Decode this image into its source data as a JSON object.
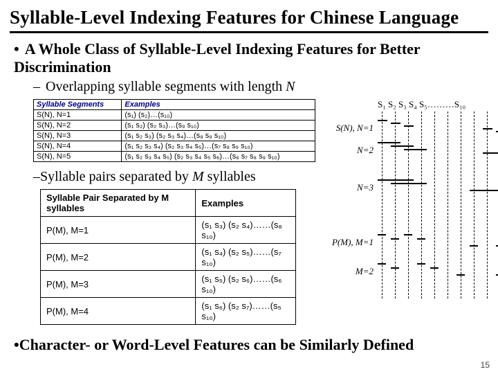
{
  "title": "Syllable-Level Indexing Features for Chinese Language",
  "bullet1": "A Whole Class of Syllable-Level Indexing Features for Better Discrimination",
  "sub1_prefix": "Overlapping syllable segments with length ",
  "sub1_ital": "N",
  "table1": {
    "headers": [
      "Syllable Segments",
      "Examples"
    ],
    "rows": [
      [
        "S(N), N=1",
        "(s₁) (s₂)…(s₁₀)"
      ],
      [
        "S(N), N=2",
        "(s₁ s₂) (s₂ s₃)…(s₉ s₁₀)"
      ],
      [
        "S(N), N=3",
        "(s₁ s₂ s₃) (s₂ s₃ s₄)…(s₈ s₉ s₁₀)"
      ],
      [
        "S(N), N=4",
        "(s₁ s₂ s₃ s₄) (s₂ s₃ s₄ s₅)…(s₇ s₈ s₉ s₁₀)"
      ],
      [
        "S(N), N=5",
        "(s₁ s₂ s₃ s₄ s₅) (s₂ s₃ s₄ s₅ s₆)…(s₆ s₇ s₈ s₉ s₁₀)"
      ]
    ]
  },
  "sub2_prefix": "Syllable pairs separated by ",
  "sub2_ital": "M",
  "sub2_suffix": " syllables",
  "table2": {
    "headers": [
      "Syllable Pair Separated by M syllables",
      "Examples"
    ],
    "rows": [
      [
        "P(M), M=1",
        "(s₁ s₃) (s₂ s₄)……(s₈ s₁₀)"
      ],
      [
        "P(M), M=2",
        "(s₁ s₄) (s₂ s₅)……(s₇ s₁₀)"
      ],
      [
        "P(M), M=3",
        "(s₁ s₅) (s₂ s₆)……(s₆ s₁₀)"
      ],
      [
        "P(M), M=4",
        "(s₁ s₆) (s₂ s₇)……(s₅ s₁₀)"
      ]
    ]
  },
  "bullet2": "Character- or Word-Level Features can be Similarly Defined",
  "diag": {
    "syllables": "S₁ S₂ S₃ S₄  S₅………S₁₀",
    "labels": [
      "S(N), N=1",
      "N=2",
      "N=3",
      "P(M), M=1",
      "M=2"
    ]
  },
  "page_number": "15"
}
